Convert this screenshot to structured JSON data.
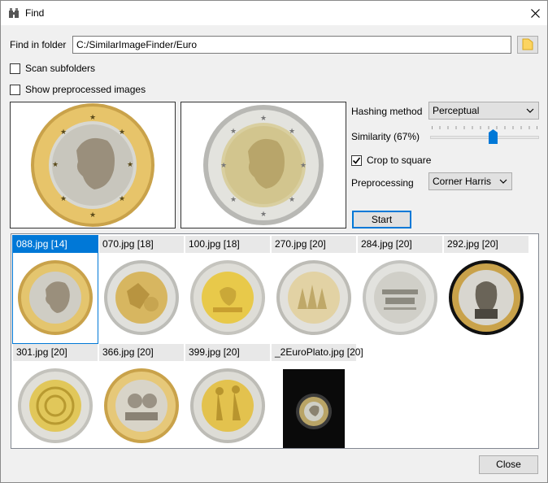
{
  "window": {
    "title": "Find"
  },
  "folder": {
    "label": "Find in folder",
    "path": "C:/SimilarImageFinder/Euro"
  },
  "options": {
    "scan_subfolders": "Scan subfolders",
    "show_preprocessed": "Show preprocessed images"
  },
  "settings": {
    "hashing_label": "Hashing method",
    "hashing_value": "Perceptual",
    "similarity_label": "Similarity (67%)",
    "similarity_value": 0.67,
    "crop_label": "Crop to square",
    "crop_checked": true,
    "preprocessing_label": "Preprocessing",
    "preprocessing_value": "Corner Harris",
    "start_label": "Start"
  },
  "results": [
    {
      "caption": "088.jpg [14]",
      "selected": true,
      "coin": "plato-gold"
    },
    {
      "caption": "070.jpg [18]",
      "selected": false,
      "coin": "mosaic-gold"
    },
    {
      "caption": "100.jpg [18]",
      "selected": false,
      "coin": "map-yellow"
    },
    {
      "caption": "270.jpg [20]",
      "selected": false,
      "coin": "trees-pale"
    },
    {
      "caption": "284.jpg [20]",
      "selected": false,
      "coin": "text-silver"
    },
    {
      "caption": "292.jpg [20]",
      "selected": false,
      "coin": "portrait-dark"
    },
    {
      "caption": "301.jpg [20]",
      "selected": false,
      "coin": "spiral-gold"
    },
    {
      "caption": "366.jpg [20]",
      "selected": false,
      "coin": "couple-pale"
    },
    {
      "caption": "399.jpg [20]",
      "selected": false,
      "coin": "figures-gold"
    },
    {
      "caption": "_2EuroPlato.jpg [20]",
      "selected": false,
      "coin": "photo-dark"
    }
  ],
  "footer": {
    "close_label": "Close"
  },
  "colors": {
    "accent": "#0078d7",
    "coin_gold": "#c9a24a",
    "coin_silver": "#c8c8c4"
  }
}
